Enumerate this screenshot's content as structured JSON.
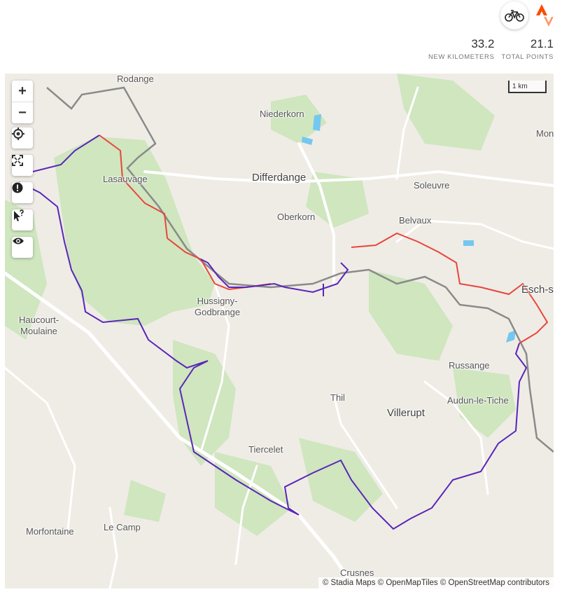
{
  "header": {
    "activity_icon": "bicycle-icon",
    "brand_icon": "strava-logo",
    "brand_color": "#fc4c02"
  },
  "stats": [
    {
      "value": "33.2",
      "label": "NEW KILOMETERS"
    },
    {
      "value": "21.1",
      "label": "TOTAL POINTS"
    }
  ],
  "map": {
    "controls": {
      "zoom_in": "+",
      "zoom_out": "−",
      "icons": [
        "locate-icon",
        "fullscreen-icon",
        "alert-icon",
        "pointer-help-icon",
        "eye-icon"
      ]
    },
    "scale_label": "1 km",
    "attribution": "© Stadia Maps © OpenMapTiles © OpenStreetMap contributors",
    "places": [
      {
        "name": "Rodange"
      },
      {
        "name": "Niederkorn"
      },
      {
        "name": "Differdange"
      },
      {
        "name": "Lasauvage"
      },
      {
        "name": "Soleuvre"
      },
      {
        "name": "Mon"
      },
      {
        "name": "Oberkorn"
      },
      {
        "name": "Belvaux"
      },
      {
        "name": "Esch-s"
      },
      {
        "name": "Hussigny-\nGodbrange"
      },
      {
        "name": "Haucourt-\nMoulaine"
      },
      {
        "name": "Russange"
      },
      {
        "name": "Thil"
      },
      {
        "name": "Audun-le-Tiche"
      },
      {
        "name": "Villerupt"
      },
      {
        "name": "Tiercelet"
      },
      {
        "name": "Le Camp"
      },
      {
        "name": "Morfontaine"
      },
      {
        "name": "Crusnes"
      }
    ],
    "colors": {
      "land": "#efece6",
      "forest": "#cfe6bf",
      "water": "#74c7f0",
      "road": "#ffffff",
      "border": "#8a8a8a",
      "route_new": "#e8453c",
      "route_main": "#5a26b8"
    }
  }
}
